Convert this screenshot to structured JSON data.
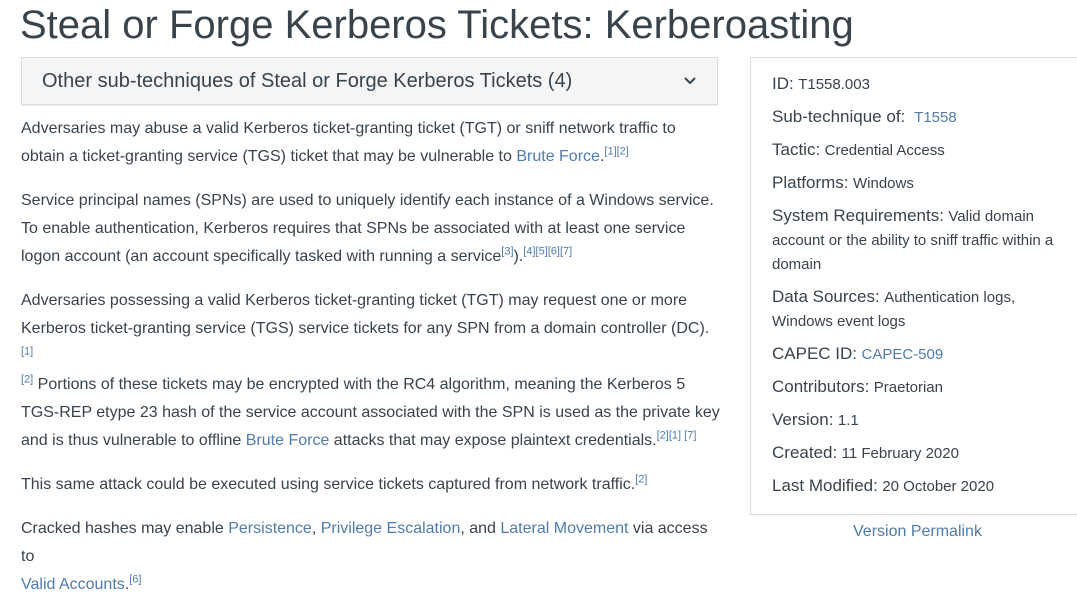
{
  "title": "Steal or Forge Kerberos Tickets: Kerberoasting",
  "subtechniques": {
    "label": "Other sub-techniques of Steal or Forge Kerberos Tickets (4)"
  },
  "desc": {
    "p1": {
      "t1": "Adversaries may abuse a valid Kerberos ticket-granting ticket (TGT) or sniff network traffic to obtain a ticket-granting service (TGS) ticket that may be vulnerable to ",
      "link1": "Brute Force",
      "t2": ".",
      "refs": [
        "[1]",
        "[2]"
      ]
    },
    "p2": {
      "t1": "Service principal names (SPNs) are used to uniquely identify each instance of a Windows service. To enable authentication, Kerberos requires that SPNs be associated with at least one service logon account (an account specifically tasked with running a service",
      "ref_inline": "[3]",
      "t2": ").",
      "refs": [
        "[4]",
        "[5]",
        "[6]",
        "[7]"
      ]
    },
    "p3": {
      "t1": "Adversaries possessing a valid Kerberos ticket-granting ticket (TGT) may request one or more Kerberos ticket-granting service (TGS) service tickets for any SPN from a domain controller (DC).",
      "refs1": [
        "[1]",
        "[2]"
      ],
      "t2": " Portions of these tickets may be encrypted with the RC4 algorithm, meaning the Kerberos 5 TGS-REP etype 23 hash of the service account associated with the SPN is used as the private key and is thus vulnerable to offline ",
      "link1": "Brute Force",
      "t3": " attacks that may expose plaintext credentials.",
      "refs2": [
        "[2]",
        "[1]",
        " [7]"
      ]
    },
    "p4": {
      "t1": "This same attack could be executed using service tickets captured from network traffic.",
      "refs": [
        "[2]"
      ]
    },
    "p5": {
      "t1": "Cracked hashes may enable ",
      "link1": "Persistence",
      "t2": ", ",
      "link2": "Privilege Escalation",
      "t3": ", and ",
      "link3": "Lateral Movement",
      "t4": " via access to ",
      "link4": "Valid Accounts",
      "t5": ".",
      "refs": [
        "[6]"
      ]
    }
  },
  "card": {
    "id": {
      "k": "ID:",
      "v": "T1558.003"
    },
    "subtechnique_of": {
      "k": "Sub-technique of:",
      "v": "T1558"
    },
    "tactic": {
      "k": "Tactic:",
      "v": "Credential Access"
    },
    "platforms": {
      "k": "Platforms:",
      "v": "Windows"
    },
    "sysreq": {
      "k": "System Requirements:",
      "v": "Valid domain account or the ability to sniff traffic within a domain"
    },
    "datasources": {
      "k": "Data Sources:",
      "v": "Authentication logs, Windows event logs"
    },
    "capec": {
      "k": "CAPEC ID:",
      "v": "CAPEC-509"
    },
    "contributors": {
      "k": "Contributors:",
      "v": "Praetorian"
    },
    "version": {
      "k": "Version:",
      "v": "1.1"
    },
    "created": {
      "k": "Created:",
      "v": "11 February 2020"
    },
    "modified": {
      "k": "Last Modified:",
      "v": "20 October 2020"
    }
  },
  "permalink": "Version Permalink",
  "colors": {
    "link": "#4f7cac",
    "text": "#39434c",
    "border": "#dcdcdc",
    "panel": "#f5f5f5"
  },
  "icons": {
    "subtech_toggle": "chevron-down-icon"
  }
}
